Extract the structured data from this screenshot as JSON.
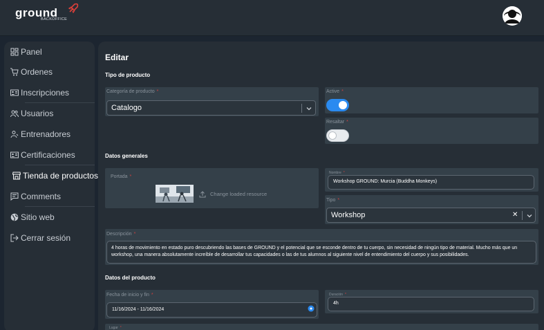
{
  "brand": {
    "logo_text": "ground",
    "logo_sub": "BACKOFFICE"
  },
  "colors": {
    "accent": "#2a8af0",
    "required": "#d04040",
    "background": "#1c2530",
    "panel": "#262e36"
  },
  "sidebar": {
    "items": [
      {
        "label": "Panel",
        "icon": "dashboard-icon"
      },
      {
        "label": "Ordenes",
        "icon": "cart-icon"
      },
      {
        "label": "Inscripciones",
        "icon": "id-card-icon"
      },
      {
        "label": "Usuarios",
        "icon": "users-icon"
      },
      {
        "label": "Entrenadores",
        "icon": "trainer-icon"
      },
      {
        "label": "Certificaciones",
        "icon": "certificate-icon"
      },
      {
        "label": "Tienda de productos",
        "icon": "store-icon",
        "active": true
      },
      {
        "label": "Comments",
        "icon": "comment-icon"
      },
      {
        "label": "Sitio web",
        "icon": "globe-icon"
      },
      {
        "label": "Cerrar sesión",
        "icon": "logout-icon"
      }
    ]
  },
  "page": {
    "title": "Editar",
    "sections": {
      "tipo_producto": "Tipo de producto",
      "datos_generales": "Datos generales",
      "datos_producto": "Datos del producto"
    }
  },
  "form": {
    "categoria": {
      "label": "Categoría de producto",
      "value": "Catalogo"
    },
    "active": {
      "label": "Active",
      "value": true
    },
    "resaltar": {
      "label": "Resaltar",
      "value": false
    },
    "portada": {
      "label": "Portada",
      "action": "Change loaded resource"
    },
    "nombre": {
      "label": "Nombre",
      "value": "Workshop GROUND: Murcia (Buddha Monkeys)"
    },
    "tipo": {
      "label": "Tipo",
      "value": "Workshop"
    },
    "descripcion": {
      "label": "Descripción",
      "value": "4 horas de movimiento en estado puro descubriendo las bases de GROUND y el potencial que se esconde dentro de tu cuerpo, sin necesidad de ningún tipo de material. Mucho más que un workshop, una manera absolutamente increíble de desarrollar tus capacidades o las de tus alumnos al siguiente nivel de entendimiento del cuerpo y sus posibilidades."
    },
    "fecha": {
      "label": "Fecha de inicio y fin",
      "value": "11/16/2024 - 11/16/2024"
    },
    "duracion": {
      "label": "Duración",
      "value": "4h"
    },
    "lugar": {
      "label": "Lugar"
    },
    "required_mark": "*"
  }
}
